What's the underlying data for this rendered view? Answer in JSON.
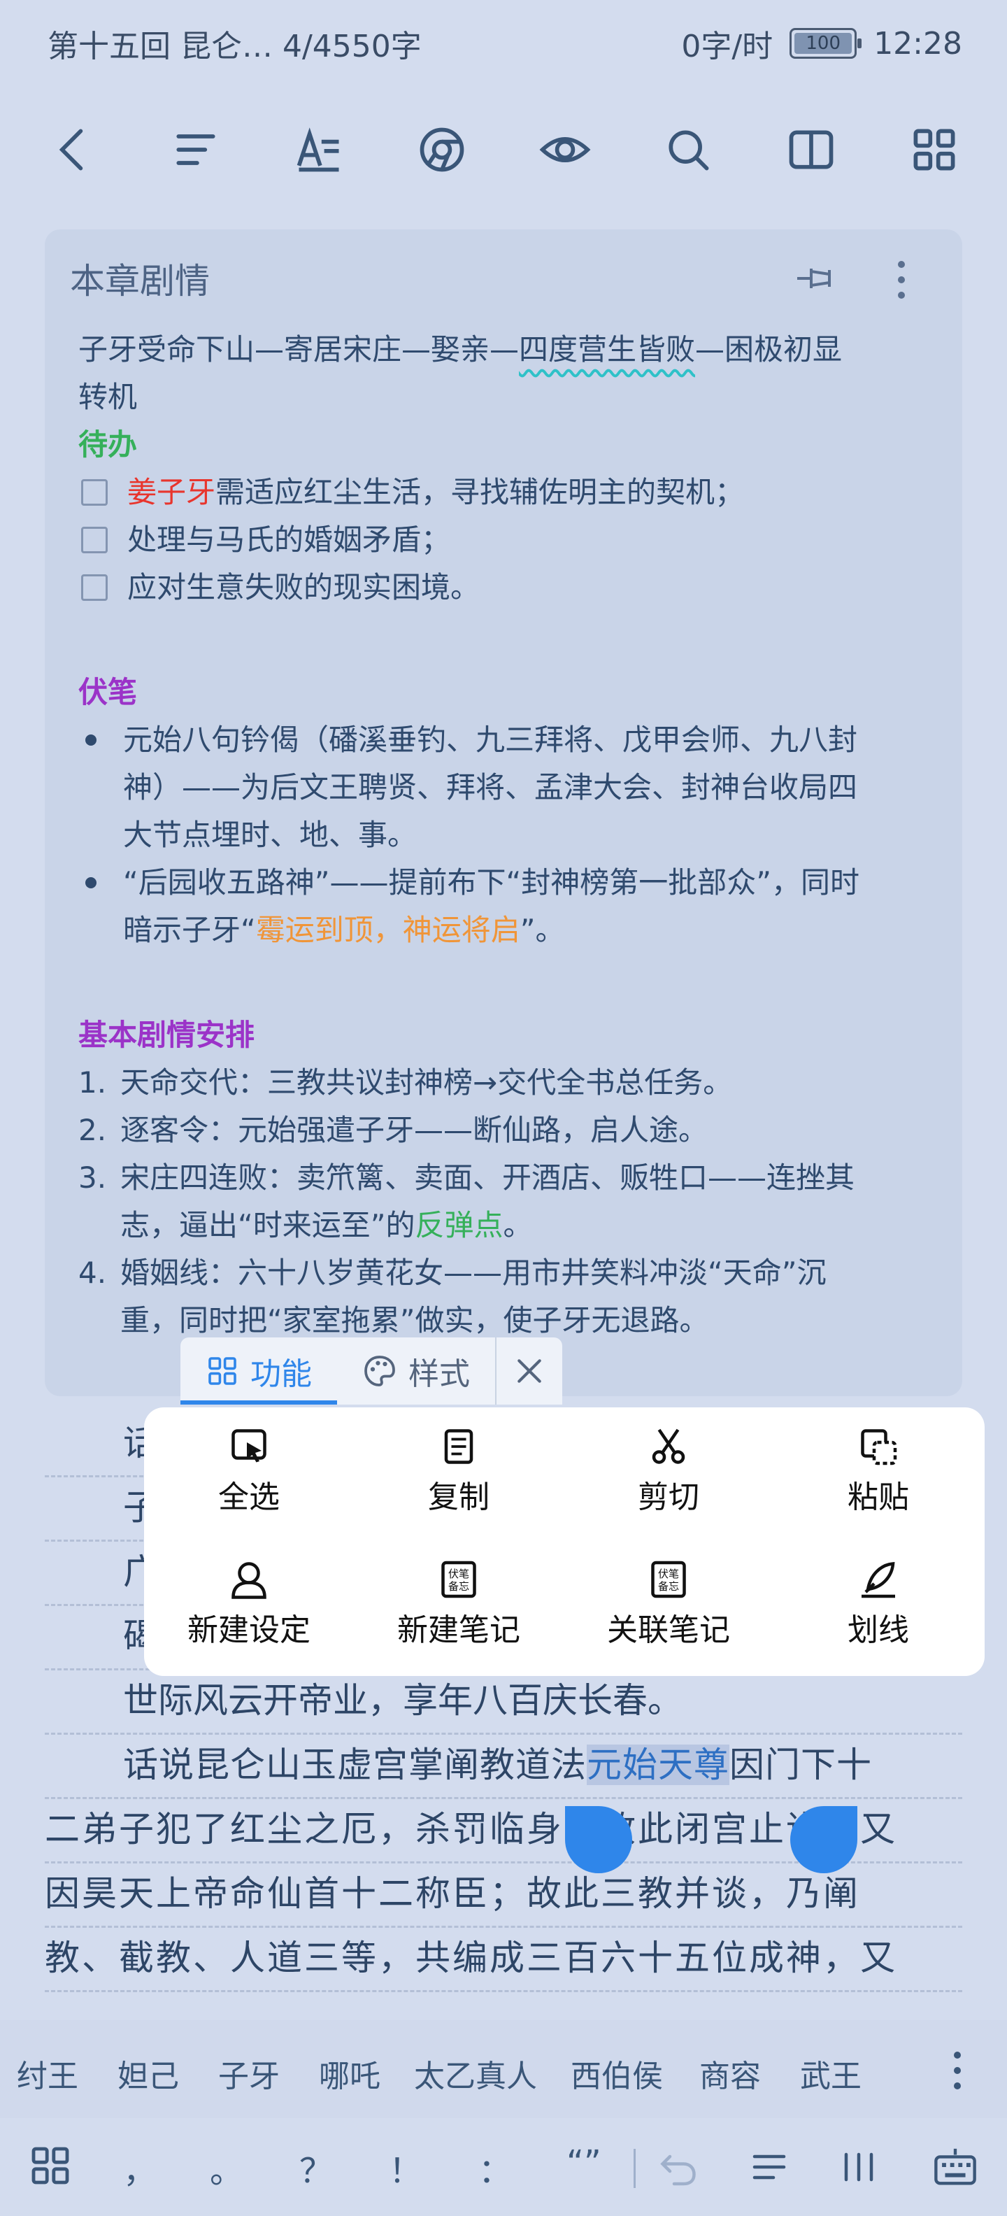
{
  "status": {
    "chapter_info": "第十五回 昆仑… 4/4550字",
    "speed": "0字/时",
    "battery": "100",
    "time": "12:28"
  },
  "toolbar": {
    "icons": [
      "back-icon",
      "outline-icon",
      "font-style-icon",
      "chrome-icon",
      "eye-icon",
      "search-icon",
      "book-icon",
      "grid-icon"
    ]
  },
  "card": {
    "title": "本章剧情",
    "plot_prefix": "子牙受命下山—寄居宋庄—娶亲—",
    "plot_wavy": "四度营生皆败",
    "plot_suffix": "—困极初显",
    "plot_line2": "转机",
    "todo_title": "待办",
    "todos": [
      {
        "red": "姜子牙",
        "rest": "需适应红尘生活，寻找辅佐明主的契机；"
      },
      {
        "red": "",
        "rest": "处理与马氏的婚姻矛盾；"
      },
      {
        "red": "",
        "rest": "应对生意失败的现实困境。"
      }
    ],
    "foreshadow_title": "伏笔",
    "foreshadow_1": [
      "元始八句钤偈（磻溪垂钓、九三拜将、戊甲会师、九八封",
      "神）——为后文王聘贤、拜将、孟津大会、封神台收局四",
      "大节点埋时、地、事。"
    ],
    "foreshadow_2_line1": "“后园收五路神”——提前布下“封神榜第一批部众”，同时",
    "foreshadow_2_pre": "暗示子牙“",
    "foreshadow_2_orange": "霉运到顶，神运将启",
    "foreshadow_2_post": "”。",
    "plan_title": "基本剧情安排",
    "plan": [
      {
        "n": "1.",
        "lines": [
          "天命交代：三教共议封神榜→交代全书总任务。"
        ]
      },
      {
        "n": "2.",
        "lines": [
          "逐客令：元始强遣子牙——断仙路，启人途。"
        ]
      },
      {
        "n": "3.",
        "lines": [
          "宋庄四连败：卖笊篱、卖面、开酒店、贩牲口——连挫其"
        ]
      },
      {
        "n": "4.",
        "lines": [
          "婚姻线：六十八岁黄花女——用市井笑料冲淡“天命”沉",
          "重，同时把“家室拖累”做实，使子牙无退路。"
        ]
      }
    ],
    "plan3_line2_pre": "志，逼出“时来运至”的",
    "plan3_line2_green": "反弹点",
    "plan3_line2_post": "。"
  },
  "body": {
    "line_a": "话",
    "line_b": "子",
    "line_c": "广",
    "line_d": "碣",
    "line_e": "世际风云开帝业，享年八百庆长春。",
    "line_f_pre": "话说昆仑山玉虚宫掌阐教道法",
    "line_f_sel": "元始天尊",
    "line_f_post": "因门下十",
    "line_g": "二弟子犯了红尘之厄，杀罚临身，故此闭宫止讲；又",
    "line_h": "因昊天上帝命仙首十二称臣；故此三教并谈，乃阐",
    "line_i": "教、截教、人道三等，共编成三百六十五位成神，又"
  },
  "popup": {
    "tab_function": "功能",
    "tab_style": "样式",
    "items": [
      {
        "label": "全选",
        "icon": "select-all-icon"
      },
      {
        "label": "复制",
        "icon": "copy-icon"
      },
      {
        "label": "剪切",
        "icon": "scissors-icon"
      },
      {
        "label": "粘贴",
        "icon": "paste-icon"
      },
      {
        "label": "新建设定",
        "icon": "person-icon"
      },
      {
        "label": "新建笔记",
        "icon": "note-icon"
      },
      {
        "label": "关联笔记",
        "icon": "note-link-icon"
      },
      {
        "label": "划线",
        "icon": "feather-icon"
      }
    ],
    "note_icon_text": "伏笔备忘"
  },
  "names": [
    "纣王",
    "妲己",
    "子牙",
    "哪吒",
    "太乙真人",
    "西伯侯",
    "商容",
    "武王"
  ],
  "keyboard": {
    "keys": [
      "，",
      "。",
      "？",
      "！",
      "：",
      "“”"
    ]
  },
  "colors": {
    "background": "#d3dcee",
    "card": "#c9d4e8",
    "accent": "#2f86ea",
    "todo": "#35b05a",
    "foreshadow": "#9b33c8",
    "highlight_red": "#e8352d",
    "highlight_orange": "#f09538"
  }
}
